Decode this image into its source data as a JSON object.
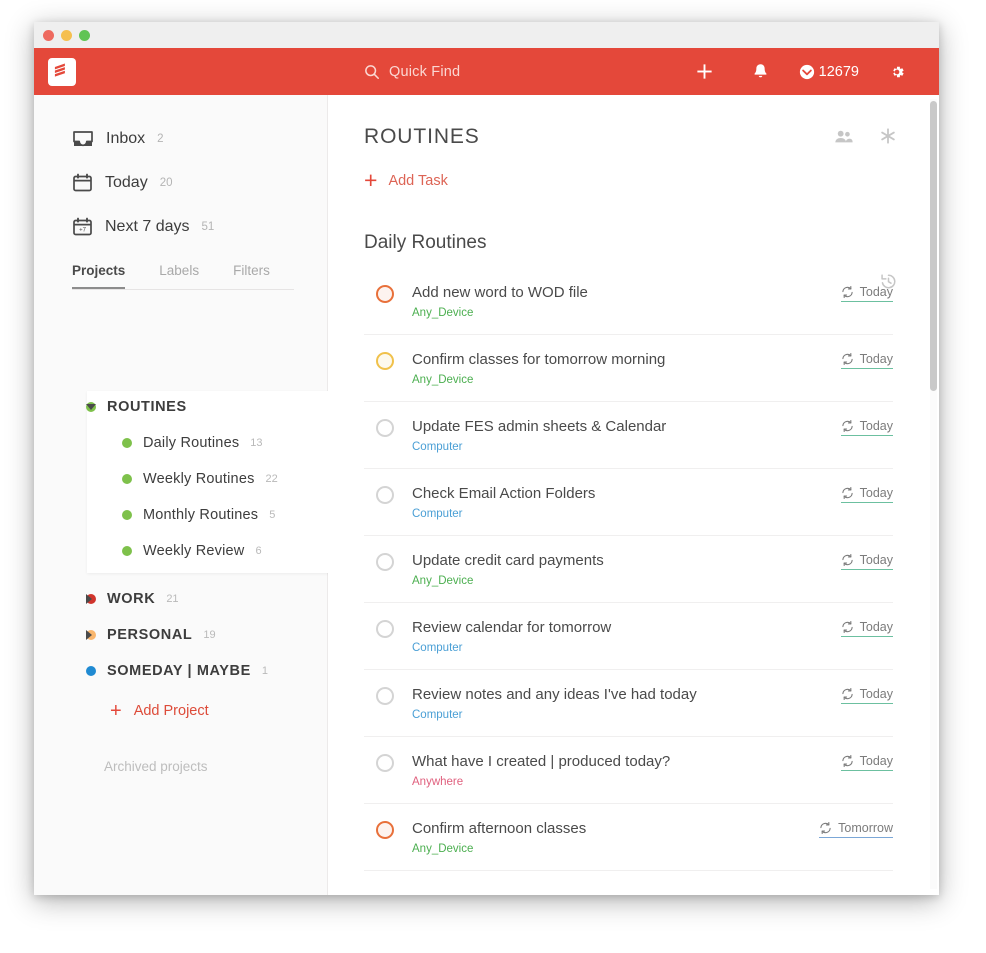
{
  "window": {
    "traffic_lights": [
      "close",
      "minimize",
      "zoom"
    ]
  },
  "topbar": {
    "logo": "todoist-logo",
    "quick_find_placeholder": "Quick Find",
    "add_label": "+",
    "notifications_icon": "bell-icon",
    "karma_points": "12679",
    "settings_icon": "gear-icon",
    "bg_color": "#e4483a"
  },
  "sidebar": {
    "nav": [
      {
        "icon": "inbox-icon",
        "label": "Inbox",
        "count": "2"
      },
      {
        "icon": "calendar-icon",
        "label": "Today",
        "count": "20"
      },
      {
        "icon": "calendar-7-icon",
        "label": "Next 7 days",
        "count": "51"
      }
    ],
    "tabs": [
      {
        "label": "Projects",
        "active": true
      },
      {
        "label": "Labels",
        "active": false
      },
      {
        "label": "Filters",
        "active": false
      }
    ],
    "projects": [
      {
        "label": "ROUTINES",
        "count": "",
        "color": "#7ec14b",
        "level": 0,
        "expanded": true,
        "selected": true
      },
      {
        "label": "Daily Routines",
        "count": "13",
        "color": "#7ec14b",
        "level": 1
      },
      {
        "label": "Weekly Routines",
        "count": "22",
        "color": "#7ec14b",
        "level": 1
      },
      {
        "label": "Monthly Routines",
        "count": "5",
        "color": "#7ec14b",
        "level": 1
      },
      {
        "label": "Weekly Review",
        "count": "6",
        "color": "#7ec14b",
        "level": 1
      },
      {
        "label": "WORK",
        "count": "21",
        "color": "#d0342c",
        "level": 0,
        "expanded": false
      },
      {
        "label": "PERSONAL",
        "count": "19",
        "color": "#f9b66d",
        "level": 0,
        "expanded": false
      },
      {
        "label": "SOMEDAY | MAYBE",
        "count": "1",
        "color": "#1f8ad2",
        "level": 0
      }
    ],
    "add_project_label": "Add Project",
    "archived_label": "Archived projects"
  },
  "main": {
    "title": "ROUTINES",
    "add_task_label": "Add Task",
    "header_icons": [
      "people-icon",
      "sparkle-icon",
      "history-icon"
    ],
    "section_title": "Daily Routines",
    "tasks": [
      {
        "title": "Add new word to WOD file",
        "label": "Any_Device",
        "label_color": "#4caf50",
        "date": "Today",
        "priority": "p2",
        "recurring": true
      },
      {
        "title": "Confirm classes for tomorrow morning",
        "label": "Any_Device",
        "label_color": "#4caf50",
        "date": "Today",
        "priority": "p3",
        "recurring": true
      },
      {
        "title": "Update FES admin sheets & Calendar",
        "label": "Computer",
        "label_color": "#4a9fd5",
        "date": "Today",
        "priority": "p4",
        "recurring": true
      },
      {
        "title": "Check Email Action Folders",
        "label": "Computer",
        "label_color": "#4a9fd5",
        "date": "Today",
        "priority": "p4",
        "recurring": true
      },
      {
        "title": "Update credit card payments",
        "label": "Any_Device",
        "label_color": "#4caf50",
        "date": "Today",
        "priority": "p4",
        "recurring": true
      },
      {
        "title": "Review calendar for tomorrow",
        "label": "Computer",
        "label_color": "#4a9fd5",
        "date": "Today",
        "priority": "p4",
        "recurring": true
      },
      {
        "title": "Review notes and any ideas I've had today",
        "label": "Computer",
        "label_color": "#4a9fd5",
        "date": "Today",
        "priority": "p4",
        "recurring": true
      },
      {
        "title": "What have I created | produced today?",
        "label": "Anywhere",
        "label_color": "#e0607e",
        "date": "Today",
        "priority": "p4",
        "recurring": true
      },
      {
        "title": "Confirm afternoon classes",
        "label": "Any_Device",
        "label_color": "#4caf50",
        "date": "Tomorrow",
        "priority": "p2",
        "recurring": true
      }
    ]
  }
}
